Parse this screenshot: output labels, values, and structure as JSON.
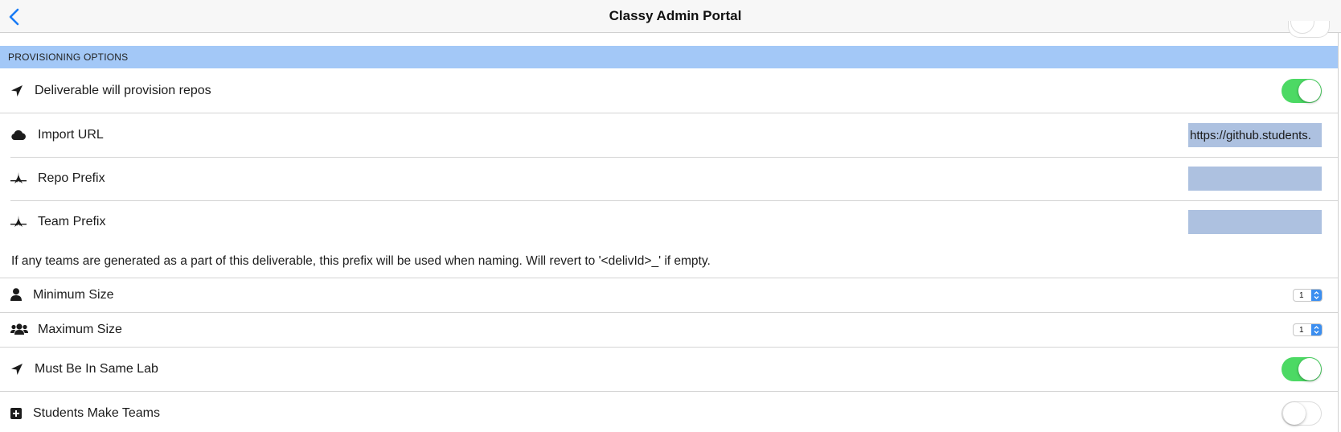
{
  "nav": {
    "title": "Classy Admin Portal",
    "back_icon": "chevron-left-icon"
  },
  "colors": {
    "accent": "#1a7cf5",
    "section_bg": "#a3c8f7",
    "toggle_on": "#4cd964",
    "input_highlight": "#adc1e0"
  },
  "section": {
    "title": "PROVISIONING OPTIONS"
  },
  "rows": {
    "provision": {
      "label": "Deliverable will provision repos",
      "icon": "location-arrow-icon",
      "toggle": true
    },
    "import_url": {
      "label": "Import URL",
      "icon": "cloud-icon",
      "value": "https://github.students."
    },
    "repo_prefix": {
      "label": "Repo Prefix",
      "icon": "code-fork-icon",
      "value": ""
    },
    "team_prefix": {
      "label": "Team Prefix",
      "icon": "code-fork-icon",
      "value": ""
    },
    "team_prefix_help": "If any teams are generated as a part of this deliverable, this prefix will be used when naming. Will revert to '<delivId>_' if empty.",
    "min_size": {
      "label": "Minimum Size",
      "icon": "user-icon",
      "value": "1"
    },
    "max_size": {
      "label": "Maximum Size",
      "icon": "users-icon",
      "value": "1"
    },
    "same_lab": {
      "label": "Must Be In Same Lab",
      "icon": "location-arrow-icon",
      "toggle": true
    },
    "students_make_teams": {
      "label": "Students Make Teams",
      "icon": "plus-square-icon",
      "toggle": false
    }
  }
}
